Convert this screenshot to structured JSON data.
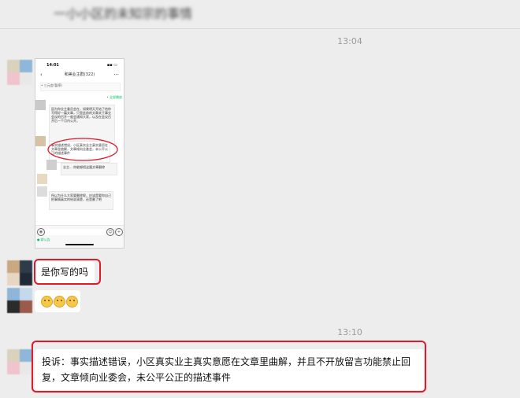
{
  "header": {
    "title": "一小小区的未知宗的事情"
  },
  "times": [
    "13:04",
    "13:10"
  ],
  "screenshot": {
    "status_time": "14:01",
    "status_icons": "▪▪ ▭",
    "chat_title": "和美业主群(322)",
    "back_icon": "chevron-left-icon",
    "more_icon": "more-icon",
    "notice": "• 三元会(暂停)",
    "tag": "• 全部播放",
    "msg1": "因为你业主委员会在，如果明天开始了给你写得好一篇文章，只是此前的文章关于事业会议的召开一般会通知大家，以及在会议召开后一个月内公开。",
    "msg2": "事实描述错误，小区真实业主真实意愿在文章里曲解，文章倾向业委会，未公平公正的描述事件",
    "msg3": "业主... 你能够把这篇文章删除",
    "msg4": "所以为什么大家要删除呢，应该是要你自己把事情真实的给说清楚，还是删了吧",
    "input_status": "● 群公告"
  },
  "messages": {
    "m2": "是你写的吗",
    "m4": "投诉：事实描述错误，小区真实业主真实意愿在文章里曲解，并且不开放留言功能禁止回复，文章倾向业委会，未公平公正的描述事件"
  },
  "colors": {
    "highlight": "#e0192b",
    "wechat_green": "#07c160",
    "bg": "#ededed"
  }
}
